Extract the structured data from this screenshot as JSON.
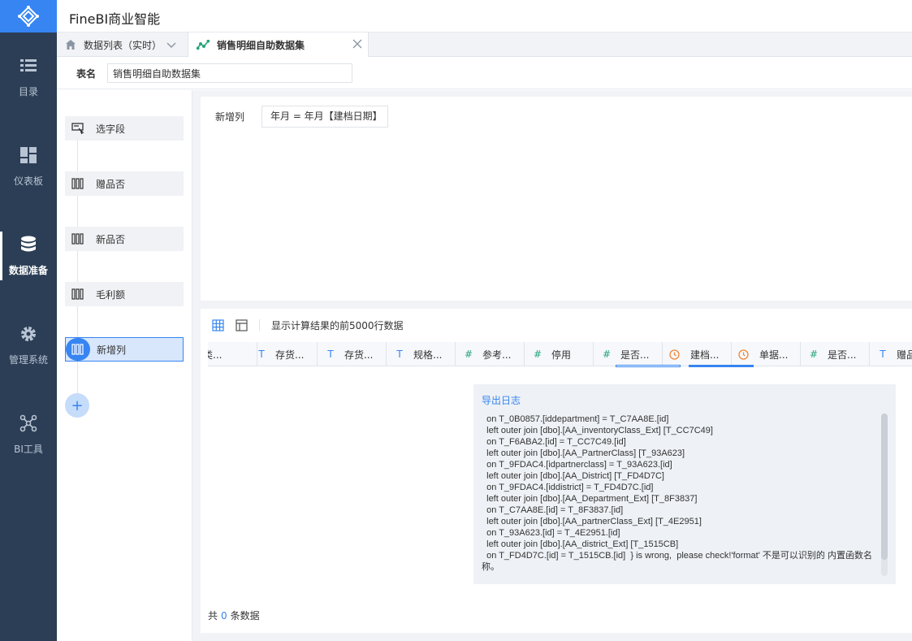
{
  "app": {
    "title": "FineBI商业智能"
  },
  "nav": [
    {
      "label": "目录",
      "icon": "list-icon"
    },
    {
      "label": "仪表板",
      "icon": "dashboard-icon"
    },
    {
      "label": "数据准备",
      "icon": "database-icon",
      "active": true
    },
    {
      "label": "管理系统",
      "icon": "gear-icon"
    },
    {
      "label": "BI工具",
      "icon": "network-icon"
    }
  ],
  "tabs": [
    {
      "label": "数据列表（实时）"
    },
    {
      "label": "销售明细自助数据集"
    }
  ],
  "table_name": {
    "label": "表名",
    "value": "销售明细自助数据集"
  },
  "steps": [
    {
      "label": "选字段"
    },
    {
      "label": "赠品否"
    },
    {
      "label": "新品否"
    },
    {
      "label": "毛利额"
    },
    {
      "label": "新增列",
      "active": true
    }
  ],
  "add_step": "+",
  "config": {
    "label": "新增列",
    "formula": "年月 = 年月【建档日期】"
  },
  "preview": {
    "info": "显示计算结果的前5000行数据",
    "columns": [
      {
        "type": "",
        "name": "分类..."
      },
      {
        "type": "T",
        "name": "存货..."
      },
      {
        "type": "T",
        "name": "存货..."
      },
      {
        "type": "T",
        "name": "规格..."
      },
      {
        "type": "#",
        "name": "参考..."
      },
      {
        "type": "#",
        "name": "停用"
      },
      {
        "type": "#",
        "name": "是否..."
      },
      {
        "type": "time",
        "name": "建档..."
      },
      {
        "type": "time",
        "name": "单据..."
      },
      {
        "type": "#",
        "name": "是否..."
      },
      {
        "type": "T",
        "name": "赠品"
      }
    ],
    "log_title": "导出日志",
    "log_lines": [
      "  on T_0B0857.[iddepartment] = T_C7AA8E.[id]",
      "  left outer join [dbo].[AA_inventoryClass_Ext] [T_CC7C49]",
      "  on T_F6ABA2.[id] = T_CC7C49.[id]",
      "  left outer join [dbo].[AA_PartnerClass] [T_93A623]",
      "  on T_9FDAC4.[idpartnerclass] = T_93A623.[id]",
      "  left outer join [dbo].[AA_District] [T_FD4D7C]",
      "  on T_9FDAC4.[iddistrict] = T_FD4D7C.[id]",
      "  left outer join [dbo].[AA_Department_Ext] [T_8F3837]",
      "  on T_C7AA8E.[id] = T_8F3837.[id]",
      "  left outer join [dbo].[AA_partnerClass_Ext] [T_4E2951]",
      "  on T_93A623.[id] = T_4E2951.[id]",
      "  left outer join [dbo].[AA_district_Ext] [T_1515CB]",
      "  on T_FD4D7C.[id] = T_1515CB.[id]  } is wrong,  please check!'format' 不是可以识别的 内置函数名称。"
    ],
    "count_prefix": "共",
    "count_value": "0",
    "count_suffix": "条数据"
  }
}
